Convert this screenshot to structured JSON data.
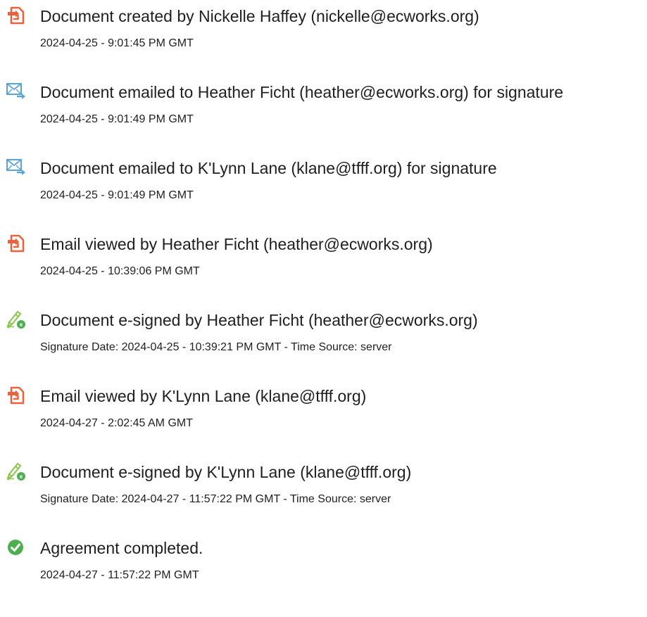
{
  "audit_events": [
    {
      "icon": "document-created-icon",
      "title": "Document created by Nickelle Haffey (nickelle@ecworks.org)",
      "timestamp": "2024-04-25 - 9:01:45 PM GMT"
    },
    {
      "icon": "email-sent-icon",
      "title": "Document emailed to Heather Ficht (heather@ecworks.org) for signature",
      "timestamp": "2024-04-25 - 9:01:49 PM GMT"
    },
    {
      "icon": "email-sent-icon",
      "title": "Document emailed to K'Lynn Lane (klane@tfff.org) for signature",
      "timestamp": "2024-04-25 - 9:01:49 PM GMT"
    },
    {
      "icon": "email-viewed-icon",
      "title": "Email viewed by Heather Ficht (heather@ecworks.org)",
      "timestamp": "2024-04-25 - 10:39:06 PM GMT"
    },
    {
      "icon": "e-signature-icon",
      "title": "Document e-signed by Heather Ficht (heather@ecworks.org)",
      "timestamp": "Signature Date: 2024-04-25 - 10:39:21 PM GMT - Time Source: server"
    },
    {
      "icon": "email-viewed-icon",
      "title": "Email viewed by K'Lynn Lane (klane@tfff.org)",
      "timestamp": "2024-04-27 - 2:02:45 AM GMT"
    },
    {
      "icon": "e-signature-icon",
      "title": "Document e-signed by K'Lynn Lane (klane@tfff.org)",
      "timestamp": "Signature Date: 2024-04-27 - 11:57:22 PM GMT - Time Source: server"
    },
    {
      "icon": "agreement-completed-icon",
      "title": "Agreement completed.",
      "timestamp": "2024-04-27 - 11:57:22 PM GMT"
    }
  ],
  "colors": {
    "document_icon": "#e8633d",
    "email_icon": "#5ba3d6",
    "signature_icon": "#8bc34a",
    "completed_icon": "#4caf50",
    "text": "#1f1f1f"
  }
}
